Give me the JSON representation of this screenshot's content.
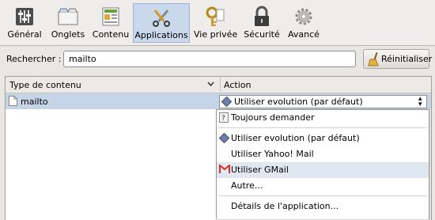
{
  "toolbar": {
    "items": [
      {
        "label": "Général",
        "icon": "general-sliders-icon"
      },
      {
        "label": "Onglets",
        "icon": "tabs-icon"
      },
      {
        "label": "Contenu",
        "icon": "content-icon"
      },
      {
        "label": "Applications",
        "icon": "applications-icon"
      },
      {
        "label": "Vie privée",
        "icon": "privacy-key-icon"
      },
      {
        "label": "Sécurité",
        "icon": "security-lock-icon"
      },
      {
        "label": "Avancé",
        "icon": "advanced-gear-icon"
      }
    ],
    "active": "Applications"
  },
  "search": {
    "label": "Rechercher :",
    "value": "mailto"
  },
  "reset_button": {
    "label": "Réinitialiser"
  },
  "table": {
    "columns": [
      "Type de contenu",
      "Action"
    ],
    "rows": [
      {
        "content_type": "mailto",
        "action": "Utiliser evolution (par défaut)"
      }
    ]
  },
  "menu": {
    "items": [
      {
        "label": "Toujours demander",
        "icon": "question-icon"
      },
      {
        "label": "Utiliser evolution (par défaut)",
        "icon": "diamond-icon"
      },
      {
        "label": "Utiliser Yahoo! Mail",
        "icon": ""
      },
      {
        "label": "Utiliser GMail",
        "icon": "gmail-icon"
      },
      {
        "label": "Autre...",
        "icon": ""
      },
      {
        "label": "Détails de l'application...",
        "icon": ""
      }
    ],
    "highlighted": "Utiliser GMail"
  },
  "colors": {
    "selection": "#c6d4e7",
    "active_tab": "#cad8eb",
    "menu_hover": "#dfe7f1",
    "gmail_red": "#d93025"
  }
}
